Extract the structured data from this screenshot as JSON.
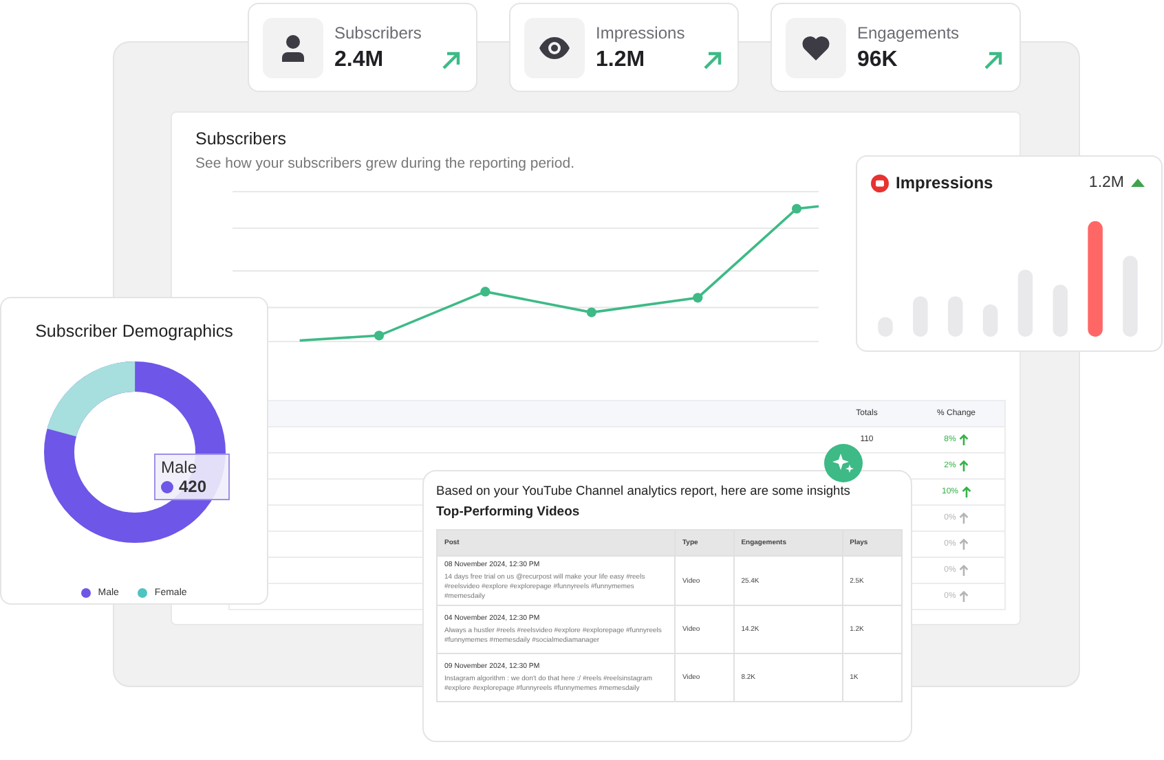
{
  "stats": [
    {
      "label": "Subscribers",
      "value": "2.4M"
    },
    {
      "label": "Impressions",
      "value": "1.2M"
    },
    {
      "label": "Engagements",
      "value": "96K"
    }
  ],
  "subscribers_card": {
    "title": "Subscribers",
    "subtitle": "See how your subscribers grew during the reporting period."
  },
  "totals_table": {
    "columns": [
      "Totals",
      "% Change"
    ],
    "rows": [
      {
        "total": "110",
        "change": "8%",
        "positive": true
      },
      {
        "change": "2%",
        "positive": true
      },
      {
        "change": "10%",
        "positive": true
      },
      {
        "change": "0%",
        "positive": false
      },
      {
        "change": "0%",
        "positive": false
      },
      {
        "change": "0%",
        "positive": false
      },
      {
        "change": "0%",
        "positive": false
      }
    ]
  },
  "impressions_card": {
    "title": "Impressions",
    "value": "1.2M"
  },
  "demographics": {
    "title": "Subscriber Demographics",
    "tooltip": {
      "label": "Male",
      "value": "420"
    },
    "legend": [
      {
        "label": "Male",
        "color": "#6e56e8"
      },
      {
        "label": "Female",
        "color": "#4cc4c0"
      }
    ]
  },
  "insights": {
    "intro": "Based on your YouTube Channel analytics report, here are some insights",
    "heading": "Top-Performing Videos",
    "columns": [
      "Post",
      "Type",
      "Engagements",
      "Plays"
    ],
    "rows": [
      {
        "date": "08 November 2024, 12:30 PM",
        "text": "14 days free trial on us @recurpost will make your life easy #reels #reelsvideo #explore #explorepage #funnyreels #funnymemes #memesdaily",
        "type": "Video",
        "engagements": "25.4K",
        "plays": "2.5K"
      },
      {
        "date": "04 November 2024, 12:30 PM",
        "text": "Always a hustler #reels #reelsvideo #explore #explorepage #funnyreels #funnymemes #memesdaily #socialmediamanager",
        "type": "Video",
        "engagements": "14.2K",
        "plays": "1.2K"
      },
      {
        "date": "09 November 2024, 12:30 PM",
        "text": "Instagram algorithm : we don't do that here :/ #reels #reelsinstagram #explore #explorepage #funnyreels #funnymemes #memesdaily",
        "type": "Video",
        "engagements": "8.2K",
        "plays": "1K"
      }
    ]
  }
}
